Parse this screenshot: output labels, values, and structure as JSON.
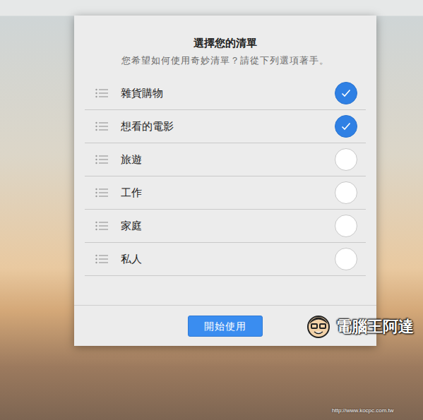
{
  "dialog": {
    "title": "選擇您的清單",
    "subtitle": "您希望如何使用奇妙清單？請從下列選項著手。",
    "options": [
      {
        "label": "雜貨購物",
        "checked": true
      },
      {
        "label": "想看的電影",
        "checked": true
      },
      {
        "label": "旅遊",
        "checked": false
      },
      {
        "label": "工作",
        "checked": false
      },
      {
        "label": "家庭",
        "checked": false
      },
      {
        "label": "私人",
        "checked": false
      }
    ],
    "button": "開始使用"
  },
  "watermark": {
    "brand": "電腦王阿達",
    "url": "http://www.kocpc.com.tw"
  }
}
